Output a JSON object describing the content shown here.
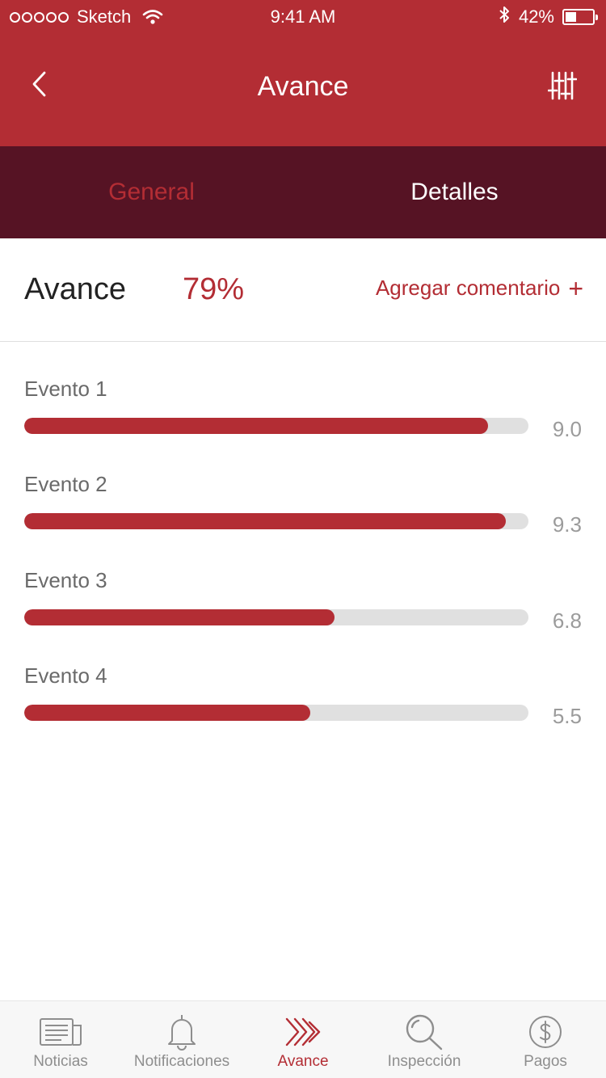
{
  "status_bar": {
    "carrier": "Sketch",
    "time": "9:41 AM",
    "battery_percent_text": "42%",
    "battery_level": 0.42
  },
  "nav": {
    "title": "Avance",
    "back_icon": "chevron-left-icon",
    "filter_icon": "sliders-icon"
  },
  "tabs": [
    {
      "label": "General",
      "active": true
    },
    {
      "label": "Detalles",
      "active": false
    }
  ],
  "summary": {
    "label": "Avance",
    "value": "79%",
    "add_comment": "Agregar comentario",
    "add_icon": "+"
  },
  "events": [
    {
      "label": "Evento 1",
      "score": "9.0",
      "progress": 0.92
    },
    {
      "label": "Evento 2",
      "score": "9.3",
      "progress": 0.955
    },
    {
      "label": "Evento 3",
      "score": "6.8",
      "progress": 0.615
    },
    {
      "label": "Evento 4",
      "score": "5.5",
      "progress": 0.567
    }
  ],
  "tab_bar": [
    {
      "label": "Noticias",
      "icon": "newspaper-icon",
      "active": false
    },
    {
      "label": "Notificaciones",
      "icon": "bell-icon",
      "active": false
    },
    {
      "label": "Avance",
      "icon": "double-chevron-right-icon",
      "active": true
    },
    {
      "label": "Inspección",
      "icon": "search-icon",
      "active": false
    },
    {
      "label": "Pagos",
      "icon": "dollar-coin-icon",
      "active": false
    }
  ],
  "colors": {
    "primary": "#b32d34",
    "tabs_bg": "#561324",
    "track": "#e0e0e0",
    "muted": "#8e8e8e"
  }
}
